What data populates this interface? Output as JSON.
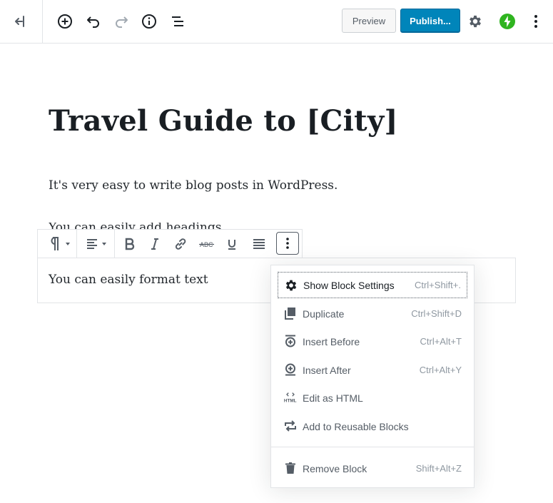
{
  "header": {
    "preview_label": "Preview",
    "publish_label": "Publish..."
  },
  "editor": {
    "post_title": "Travel Guide to [City]",
    "paragraphs": [
      "It's very easy to write blog posts in WordPress.",
      "You can easily format text"
    ],
    "obscured_line_text": "You can easily add headings"
  },
  "block_menu": {
    "items": [
      {
        "icon": "gear-icon",
        "label": "Show Block Settings",
        "shortcut": "Ctrl+Shift+."
      },
      {
        "icon": "duplicate-icon",
        "label": "Duplicate",
        "shortcut": "Ctrl+Shift+D"
      },
      {
        "icon": "insert-before-icon",
        "label": "Insert Before",
        "shortcut": "Ctrl+Alt+T"
      },
      {
        "icon": "insert-after-icon",
        "label": "Insert After",
        "shortcut": "Ctrl+Alt+Y"
      },
      {
        "icon": "html-icon",
        "label": "Edit as HTML",
        "shortcut": ""
      },
      {
        "icon": "reusable-icon",
        "label": "Add to Reusable Blocks",
        "shortcut": ""
      },
      {
        "icon": "trash-icon",
        "label": "Remove Block",
        "shortcut": "Shift+Alt+Z"
      }
    ]
  },
  "icons": {
    "topbar": [
      "back-icon",
      "add-block-icon",
      "undo-icon",
      "redo-icon",
      "info-icon",
      "outline-icon",
      "settings-gear-icon",
      "jetpack-icon",
      "more-vertical-icon"
    ],
    "block_toolbar": [
      "paragraph-icon",
      "align-left-icon",
      "bold-icon",
      "italic-icon",
      "link-icon",
      "strikethrough-icon",
      "underline-icon",
      "justify-icon",
      "more-vertical-icon"
    ]
  },
  "colors": {
    "publish": "#0085ba",
    "jetpack": "#2fb41f",
    "text": "#191e23",
    "muted": "#555d66"
  }
}
